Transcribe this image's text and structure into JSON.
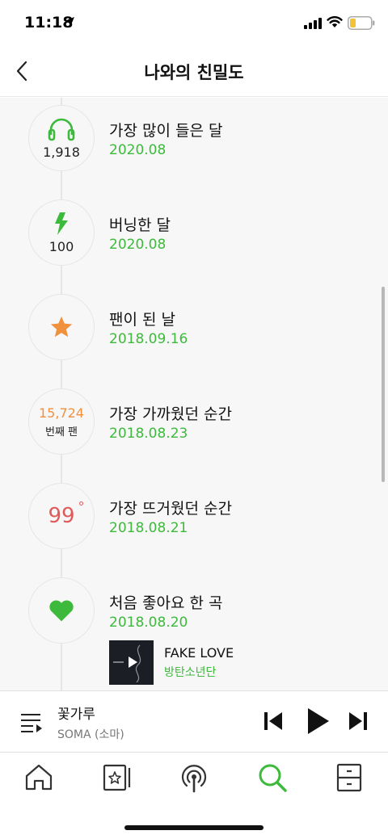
{
  "status_bar": {
    "time": "11:18"
  },
  "header": {
    "title": "나와의 친밀도"
  },
  "timeline": [
    {
      "title": "가장 많이 들은 달",
      "date": "2020.08",
      "icon": "headphones-icon",
      "count": "1,918"
    },
    {
      "title": "버닝한 달",
      "date": "2020.08",
      "icon": "lightning-icon",
      "count": "100"
    },
    {
      "title": "팬이 된 날",
      "date": "2018.09.16",
      "icon": "star-icon"
    },
    {
      "title": "가장 가까웠던 순간",
      "date": "2018.08.23",
      "fan_number": "15,724",
      "fan_label": "번째 팬"
    },
    {
      "title": "가장 뜨거웠던 순간",
      "date": "2018.08.21",
      "temperature": "99",
      "degree": "°"
    },
    {
      "title": "처음 좋아요 한 곡",
      "date": "2018.08.20",
      "icon": "heart-icon",
      "song": {
        "title": "FAKE LOVE",
        "artist": "방탄소년단"
      }
    }
  ],
  "mini_player": {
    "title": "꽃가루",
    "artist": "SOMA (소마)"
  },
  "tabs": [
    "home-tab",
    "storage-tab",
    "podcast-tab",
    "search-tab",
    "library-tab"
  ],
  "colors": {
    "accent": "#3dba3c",
    "fan_orange": "#f0913e",
    "temp_red": "#e05a5a",
    "star_orange": "#f0913e"
  }
}
